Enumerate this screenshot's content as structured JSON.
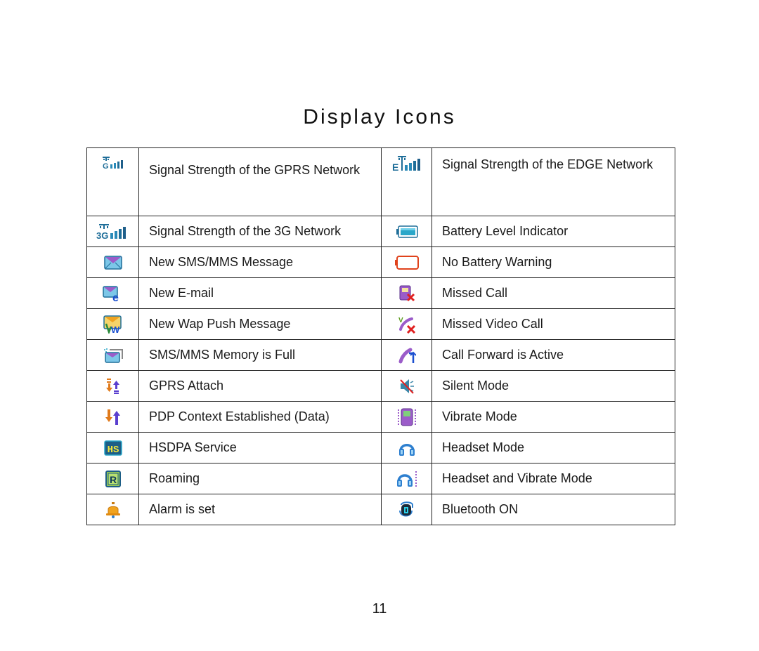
{
  "page": {
    "title": "Display Icons",
    "page_number": "11"
  },
  "colors": {
    "signal_blue": "#1f6e99",
    "battery_teal": "#2aa7c9",
    "battery_warning": "#e0421b",
    "envelope_purple": "#9b5cc9",
    "envelope_blue": "#7cc7e8",
    "arrow_orange": "#e07a1b",
    "arrow_purple": "#5a3fcf",
    "hsdpa_yellow": "#f5e63a",
    "hsdpa_bg": "#1d5e86",
    "roaming_green": "#9ccc52",
    "alarm_orange": "#f0a31f",
    "headset_blue": "#2d7fcf",
    "missed_red": "#e02020",
    "table_border": "#222222"
  },
  "rows": [
    {
      "left": {
        "icon": "gprs-signal-icon",
        "label": "Signal Strength of the GPRS Network"
      },
      "right": {
        "icon": "edge-signal-icon",
        "label": "Signal Strength of the EDGE Network"
      }
    },
    {
      "left": {
        "icon": "3g-signal-icon",
        "label": "Signal Strength of the 3G Network"
      },
      "right": {
        "icon": "battery-level-icon",
        "label": "Battery Level Indicator"
      }
    },
    {
      "left": {
        "icon": "sms-mms-message-icon",
        "label": "New SMS/MMS Message"
      },
      "right": {
        "icon": "no-battery-icon",
        "label": "No Battery Warning"
      }
    },
    {
      "left": {
        "icon": "email-icon",
        "label": "New E-mail"
      },
      "right": {
        "icon": "missed-call-icon",
        "label": "Missed Call"
      }
    },
    {
      "left": {
        "icon": "wap-push-icon",
        "label": "New Wap Push Message"
      },
      "right": {
        "icon": "missed-video-call-icon",
        "label": "Missed Video Call"
      }
    },
    {
      "left": {
        "icon": "memory-full-icon",
        "label": "SMS/MMS Memory is Full"
      },
      "right": {
        "icon": "call-forward-icon",
        "label": "Call Forward is Active"
      }
    },
    {
      "left": {
        "icon": "gprs-attach-icon",
        "label": "GPRS Attach"
      },
      "right": {
        "icon": "silent-mode-icon",
        "label": "Silent Mode"
      }
    },
    {
      "left": {
        "icon": "pdp-context-icon",
        "label": "PDP Context Established (Data)"
      },
      "right": {
        "icon": "vibrate-mode-icon",
        "label": "Vibrate Mode"
      }
    },
    {
      "left": {
        "icon": "hsdpa-icon",
        "label": "HSDPA Service",
        "glyph": "HS"
      },
      "right": {
        "icon": "headset-icon",
        "label": "Headset Mode"
      }
    },
    {
      "left": {
        "icon": "roaming-icon",
        "label": "Roaming",
        "glyph": "R"
      },
      "right": {
        "icon": "headset-vibrate-icon",
        "label": "Headset and Vibrate Mode"
      }
    },
    {
      "left": {
        "icon": "alarm-bell-icon",
        "label": "Alarm is set"
      },
      "right": {
        "icon": "bluetooth-icon",
        "label": "Bluetooth ON"
      }
    }
  ]
}
